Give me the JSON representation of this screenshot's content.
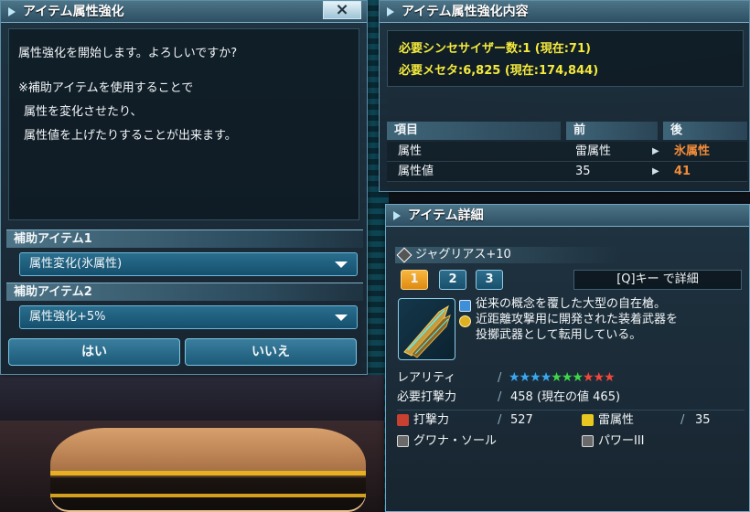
{
  "dialog": {
    "title": "アイテム属性強化",
    "close_icon": "×",
    "message_line1": "属性強化を開始します。よろしいですか?",
    "message_line2": "※補助アイテムを使用することで",
    "message_line3": "属性を変化させたり、",
    "message_line4": "属性値を上げたりすることが出来ます。",
    "support1_label": "補助アイテム1",
    "support1_value": "属性変化(氷属性)",
    "support2_label": "補助アイテム2",
    "support2_value": "属性強化+5%",
    "yes_label": "はい",
    "no_label": "いいえ"
  },
  "info": {
    "title": "アイテム属性強化内容",
    "cost1": "必要シンセサイザー数:1 (現在:71)",
    "cost2": "必要メセタ:6,825 (現在:174,844)",
    "col_item": "項目",
    "col_before": "前",
    "col_after": "後",
    "rows": [
      {
        "label": "属性",
        "before": "雷属性",
        "after": "氷属性"
      },
      {
        "label": "属性値",
        "before": "35",
        "after": "41"
      }
    ]
  },
  "detail": {
    "title": "アイテム詳細",
    "item_name": "ジャグリアス+10",
    "tabs": [
      "1",
      "2",
      "3"
    ],
    "detail_key": "[Q]キー で詳細",
    "desc1": "従来の概念を覆した大型の自在槍。",
    "desc2": "近距離攻撃用に開発された装着武器を",
    "desc3": "投擲武器として転用している。",
    "rarity_label": "レアリティ",
    "rarity_stars": 10,
    "required_label": "必要打撃力",
    "required_value": "458 (現在の値 465)",
    "attack_label": "打撃力",
    "attack_value": "527",
    "element_label": "雷属性",
    "element_value": "35",
    "ability1": "グワナ・ソール",
    "ability2": "パワーIII"
  },
  "colors": {
    "yellow_text": "#f4e93c",
    "orange_text": "#f28c3a",
    "star_blue": "#3aa8f0",
    "star_green": "#3ed84a",
    "star_red": "#f0483a"
  }
}
